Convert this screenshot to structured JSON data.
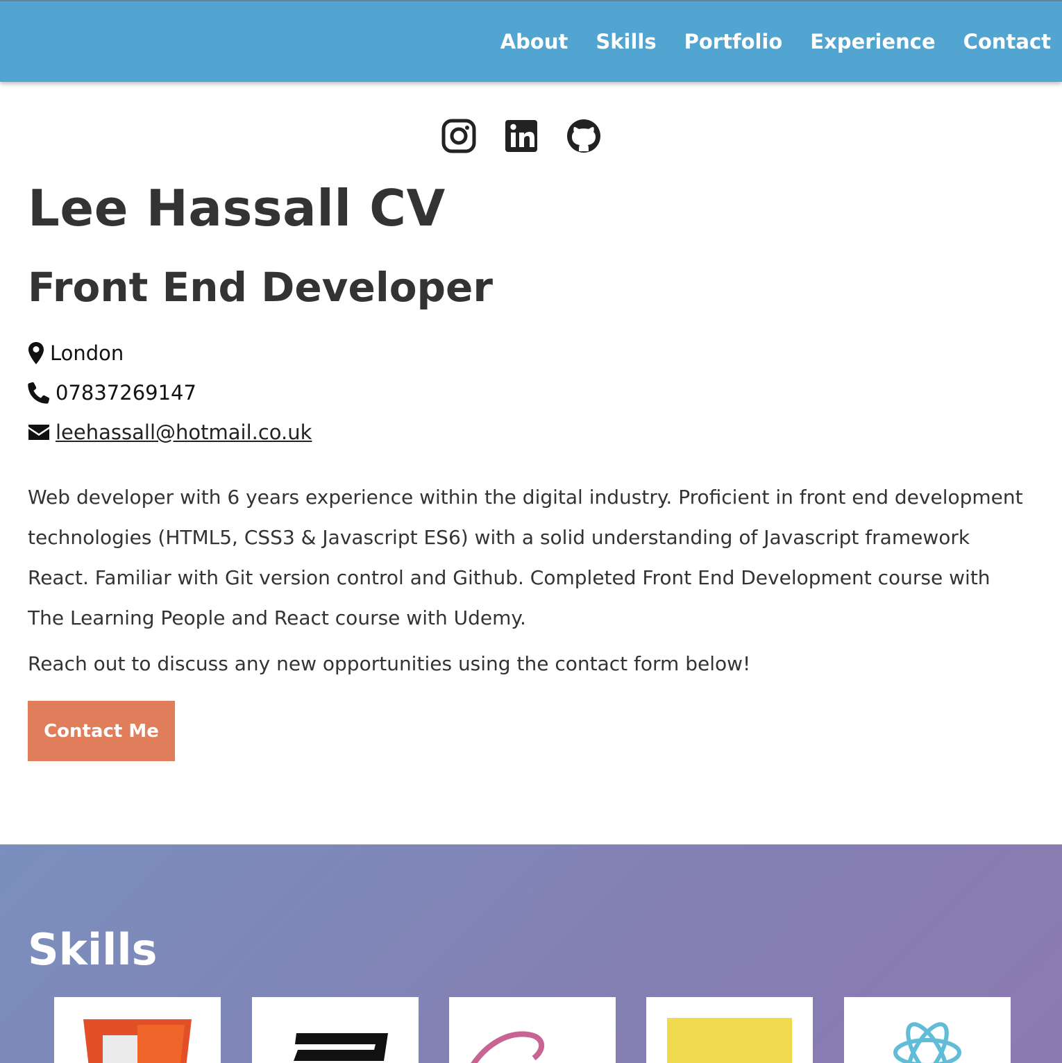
{
  "nav": {
    "items": [
      {
        "label": "About"
      },
      {
        "label": "Skills"
      },
      {
        "label": "Portfolio"
      },
      {
        "label": "Experience"
      },
      {
        "label": "Contact"
      }
    ]
  },
  "social": [
    "instagram-icon",
    "linkedin-icon",
    "github-icon"
  ],
  "hero": {
    "title": "Lee Hassall CV",
    "subtitle": "Front End Developer",
    "location": "London",
    "phone": "07837269147",
    "email": "leehassall@hotmail.co.uk",
    "bio": "Web developer with 6 years experience within the digital industry. Proficient in front end development technologies (HTML5, CSS3 & Javascript ES6) with a solid understanding of Javascript framework React. Familiar with Git version control and Github. Completed Front End Development course with The Learning People and React course with Udemy.",
    "cta_text": "Reach out to discuss any new opportunities using the contact form below!",
    "button_label": "Contact Me"
  },
  "skills": {
    "heading": "Skills",
    "cards": [
      "html5-icon",
      "css3-icon",
      "sass-icon",
      "javascript-icon",
      "react-icon"
    ]
  },
  "colors": {
    "nav_bg": "#52a4d1",
    "button_bg": "#e07d5a",
    "text": "#333333",
    "skills_gradient_start": "#7a8fbd",
    "skills_gradient_end": "#8b7ab0"
  }
}
